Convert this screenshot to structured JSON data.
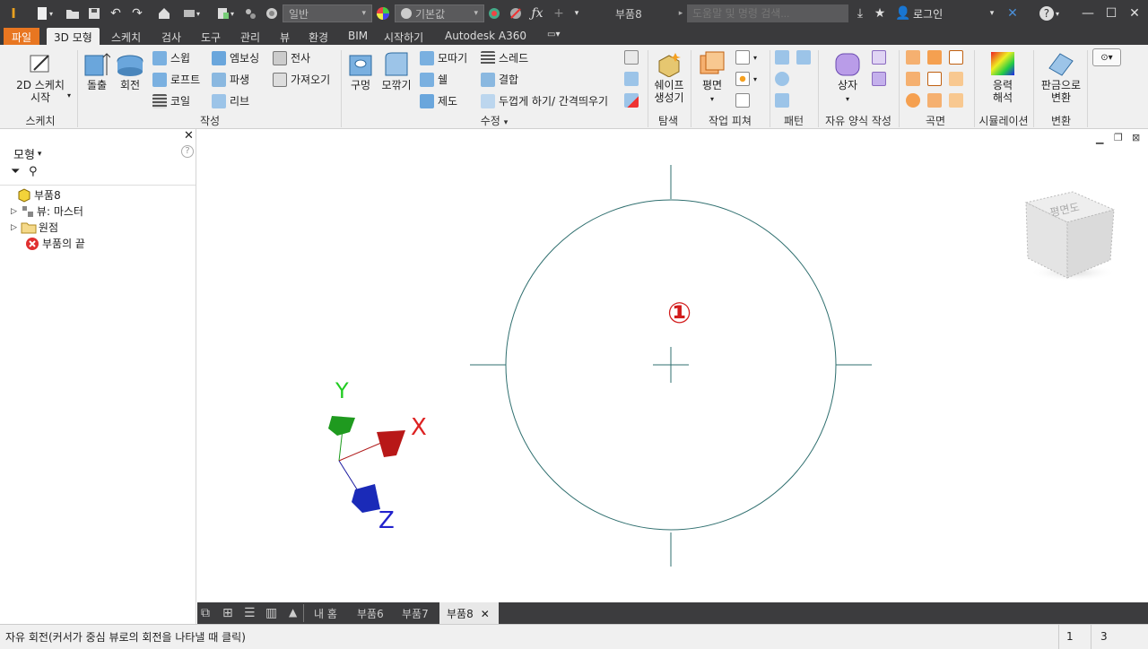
{
  "titlebar": {
    "doc_title": "부품8",
    "material_dropdown": "일반",
    "appearance_dropdown": "기본값",
    "search_placeholder": "도움말 및 명령 검색...",
    "login_label": "로그인",
    "icons": [
      "inventor-logo-icon",
      "new-icon",
      "open-icon",
      "save-icon",
      "undo-icon",
      "redo-icon",
      "home-icon",
      "return-icon",
      "select-icon",
      "properties-icon",
      "appearance-icon",
      "color-override-icon",
      "clear-override-icon",
      "fx-icon",
      "plus-icon",
      "star-icon",
      "user-icon",
      "exchange-icon",
      "help-icon",
      "minimize-icon",
      "maximize-icon",
      "close-icon"
    ]
  },
  "ribbon_tabs": [
    "파일",
    "3D 모형",
    "스케치",
    "검사",
    "도구",
    "관리",
    "뷰",
    "환경",
    "BIM",
    "시작하기",
    "Autodesk A360"
  ],
  "active_tab": "3D 모형",
  "ribbon": {
    "sketch": {
      "start_sketch": "2D 스케치\n시작",
      "group": "스케치"
    },
    "create": {
      "extrude": "돌출",
      "revolve": "회전",
      "sweep": "스윕",
      "loft": "로프트",
      "coil": "코일",
      "emboss": "엠보싱",
      "derive": "파생",
      "rib": "리브",
      "decal": "전사",
      "import": "가져오기",
      "group": "작성"
    },
    "modify": {
      "hole": "구멍",
      "fillet": "모깎기",
      "chamfer": "모따기",
      "shell": "쉘",
      "draft": "제도",
      "thread": "스레드",
      "combine": "결합",
      "thicken": "두껍게 하기/ 간격띄우기",
      "group": "수정"
    },
    "explore": {
      "shape_generator": "쉐이프\n생성기",
      "group": "탐색"
    },
    "work_features": {
      "plane": "평면",
      "group": "작업 피쳐"
    },
    "pattern": {
      "group": "패턴"
    },
    "freeform": {
      "box": "상자",
      "group": "자유 양식 작성"
    },
    "surface": {
      "group": "곡면"
    },
    "simulation": {
      "stress": "응력\n해석",
      "group": "시뮬레이션"
    },
    "convert": {
      "sheet_metal": "판금으로\n변환",
      "group": "변환"
    }
  },
  "browser": {
    "title": "모형",
    "items": [
      {
        "label": "부품8",
        "icon": "part-icon"
      },
      {
        "label": "뷰: 마스터",
        "icon": "view-icon"
      },
      {
        "label": "원점",
        "icon": "folder-icon"
      },
      {
        "label": "부품의 끝",
        "icon": "end-of-part-icon"
      }
    ]
  },
  "viewport": {
    "marker": "①",
    "viewcube_label": "평면도",
    "axis_labels": {
      "x": "X",
      "y": "Y",
      "z": "Z"
    }
  },
  "doc_tabs": [
    "내 홈",
    "부품6",
    "부품7",
    "부품8"
  ],
  "active_doc": "부품8",
  "status": {
    "message": "자유 회전(커서가 중심 뷰로의 회전을 나타낼 때 클릭)",
    "count1": "1",
    "count2": "3"
  },
  "colors": {
    "file_tab": "#e87621",
    "title_bg": "#3a3a3c",
    "ribbon_bg": "#f0f0f0",
    "sketch_line": "#2f6f6f"
  }
}
